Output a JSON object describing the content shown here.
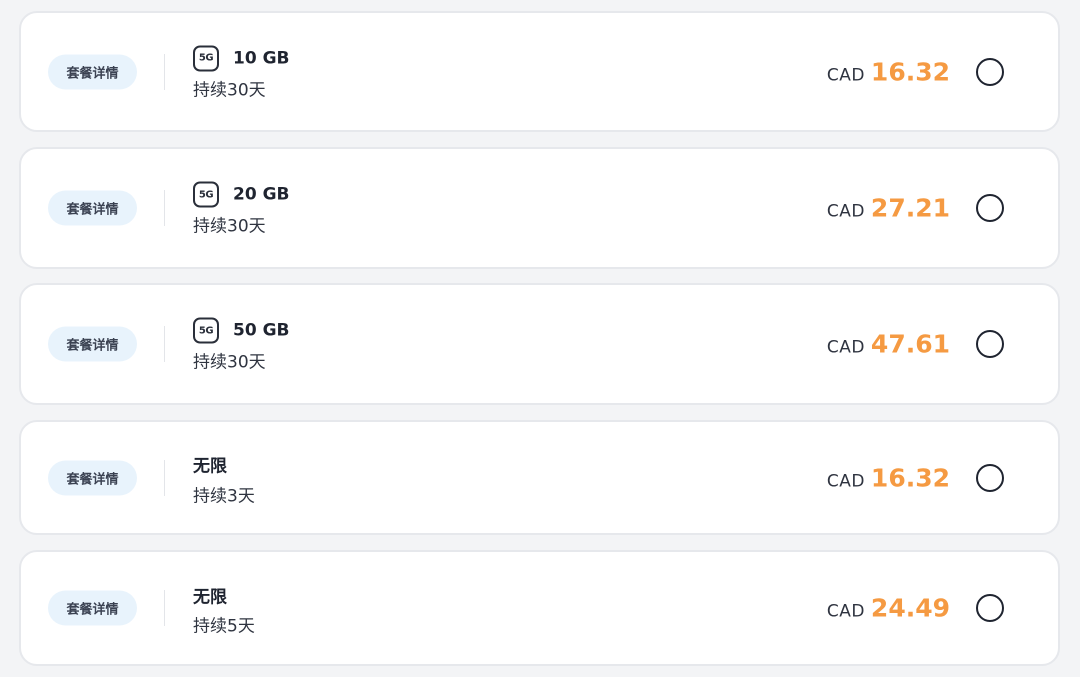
{
  "plans": [
    {
      "details_label": "套餐详情",
      "network": "5G",
      "data": "10 GB",
      "duration": "持续30天",
      "currency": "CAD",
      "price": "16.32",
      "selected": false
    },
    {
      "details_label": "套餐详情",
      "network": "5G",
      "data": "20 GB",
      "duration": "持续30天",
      "currency": "CAD",
      "price": "27.21",
      "selected": false
    },
    {
      "details_label": "套餐详情",
      "network": "5G",
      "data": "50 GB",
      "duration": "持续30天",
      "currency": "CAD",
      "price": "47.61",
      "selected": false
    },
    {
      "details_label": "套餐详情",
      "network": "",
      "data": "无限",
      "duration": "持续3天",
      "currency": "CAD",
      "price": "16.32",
      "selected": false
    },
    {
      "details_label": "套餐详情",
      "network": "",
      "data": "无限",
      "duration": "持续5天",
      "currency": "CAD",
      "price": "24.49",
      "selected": false
    }
  ],
  "colors": {
    "price_accent": "#f59a42",
    "details_bg": "#e8f3fc"
  },
  "icons": {
    "network": "5g-network-icon"
  }
}
